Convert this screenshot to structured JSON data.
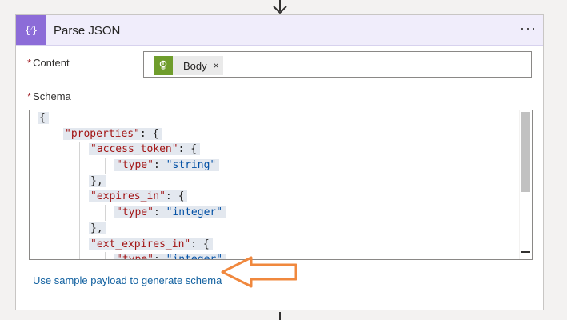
{
  "action": {
    "title": "Parse JSON",
    "icon": "parse-json-icon",
    "header_color": "#8c6cd8",
    "more_label": "···"
  },
  "content": {
    "label": "Content",
    "required_mark": "*",
    "token": {
      "label": "Body",
      "remove": "×",
      "icon": "trigger-icon",
      "icon_color": "#6f9d2c"
    }
  },
  "schema": {
    "label": "Schema",
    "required_mark": "*",
    "lines": [
      {
        "indent": 0,
        "parts": [
          {
            "t": "{",
            "c": "punc"
          }
        ]
      },
      {
        "indent": 1,
        "parts": [
          {
            "t": "\"properties\"",
            "c": "key"
          },
          {
            "t": ": {",
            "c": "punc"
          }
        ]
      },
      {
        "indent": 2,
        "parts": [
          {
            "t": "\"access_token\"",
            "c": "key"
          },
          {
            "t": ": {",
            "c": "punc"
          }
        ]
      },
      {
        "indent": 3,
        "parts": [
          {
            "t": "\"type\"",
            "c": "key"
          },
          {
            "t": ": ",
            "c": "punc"
          },
          {
            "t": "\"string\"",
            "c": "str"
          }
        ]
      },
      {
        "indent": 2,
        "parts": [
          {
            "t": "},",
            "c": "punc"
          }
        ]
      },
      {
        "indent": 2,
        "parts": [
          {
            "t": "\"expires_in\"",
            "c": "key"
          },
          {
            "t": ": {",
            "c": "punc"
          }
        ]
      },
      {
        "indent": 3,
        "parts": [
          {
            "t": "\"type\"",
            "c": "key"
          },
          {
            "t": ": ",
            "c": "punc"
          },
          {
            "t": "\"integer\"",
            "c": "str"
          }
        ]
      },
      {
        "indent": 2,
        "parts": [
          {
            "t": "},",
            "c": "punc"
          }
        ]
      },
      {
        "indent": 2,
        "parts": [
          {
            "t": "\"ext_expires_in\"",
            "c": "key"
          },
          {
            "t": ": {",
            "c": "punc"
          }
        ]
      },
      {
        "indent": 3,
        "parts": [
          {
            "t": "\"type\"",
            "c": "key"
          },
          {
            "t": ": ",
            "c": "punc"
          },
          {
            "t": "\"integer\"",
            "c": "str"
          }
        ]
      }
    ]
  },
  "sample_link": "Use sample payload to generate schema",
  "callout": {
    "icon": "left-arrow-callout-icon",
    "color": "#f0883e"
  }
}
